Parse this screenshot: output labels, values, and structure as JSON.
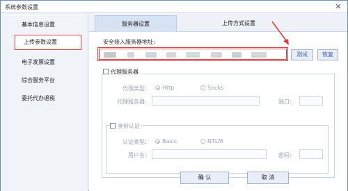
{
  "window": {
    "title": "系统参数设置",
    "close_glyph": "✕"
  },
  "sidebar": {
    "items": [
      {
        "label": "基本信息设置"
      },
      {
        "label": "上传参数设置"
      },
      {
        "label": "电子发票设置"
      },
      {
        "label": "综合服务平台"
      },
      {
        "label": "委托代办退税"
      }
    ]
  },
  "tabs": [
    {
      "label": "服务器设置"
    },
    {
      "label": "上传方式设置"
    }
  ],
  "server": {
    "address_label": "安全接入服务器地址:",
    "test_button": "测试",
    "restore_button": "恢复"
  },
  "proxy": {
    "checkbox_label": "代理服务器",
    "type_label": "代理类型:",
    "type_options": [
      "Http",
      "Socks"
    ],
    "server_label": "代理服务器:",
    "port_label": "端口:",
    "auth_checkbox_label": "身份认证",
    "auth_type_label": "认证类型:",
    "auth_options": [
      "Basic",
      "NTLM"
    ],
    "username_label": "用户名:",
    "password_label": "密码:"
  },
  "footer": {
    "ok_button": "确 认",
    "cancel_button": "取 消"
  },
  "colors": {
    "highlight_red": "#e23b3b",
    "tab_active": "#d6e3f3",
    "button_text": "#2b5ca8"
  }
}
